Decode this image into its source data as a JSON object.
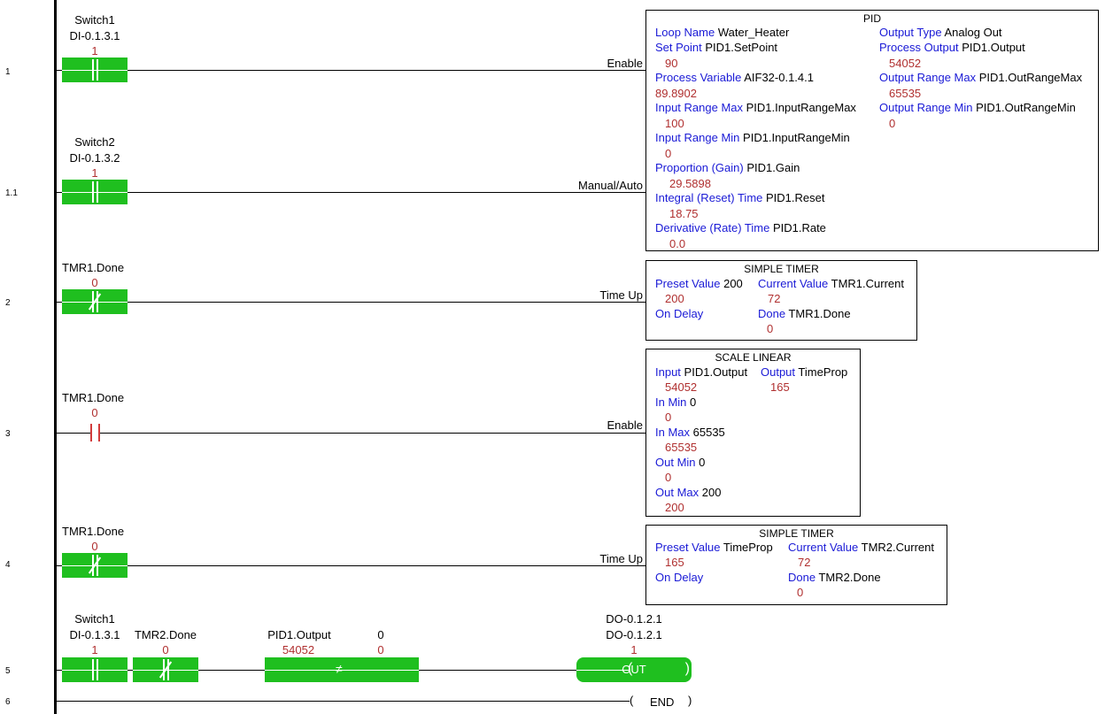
{
  "rungs": {
    "r1": "1",
    "r1_1": "1.1",
    "r2": "2",
    "r3": "3",
    "r4": "4",
    "r5": "5",
    "r6": "6"
  },
  "rung1": {
    "contact_name": "Switch1",
    "contact_addr": "DI-0.1.3.1",
    "contact_val": "1",
    "wire_label": "Enable"
  },
  "rung1_1": {
    "contact_name": "Switch2",
    "contact_addr": "DI-0.1.3.2",
    "contact_val": "1",
    "wire_label": "Manual/Auto"
  },
  "pid": {
    "title": "PID",
    "loop_name_k": "Loop Name",
    "loop_name_v": "Water_Heater",
    "set_point_k": "Set Point",
    "set_point_v": "PID1.SetPoint",
    "set_point_val": "90",
    "pv_k": "Process Variable",
    "pv_v": "AIF32-0.1.4.1",
    "pv_val": "89.8902",
    "irmax_k": "Input Range Max",
    "irmax_v": "PID1.InputRangeMax",
    "irmax_val": "100",
    "irmin_k": "Input Range Min",
    "irmin_v": "PID1.InputRangeMin",
    "irmin_val": "0",
    "gain_k": "Proportion (Gain)",
    "gain_v": "PID1.Gain",
    "gain_val": "29.5898",
    "reset_k": "Integral (Reset) Time",
    "reset_v": "PID1.Reset",
    "reset_val": "18.75",
    "rate_k": "Derivative (Rate) Time",
    "rate_v": "PID1.Rate",
    "rate_val": "0.0",
    "otype_k": "Output Type",
    "otype_v": "Analog Out",
    "pout_k": "Process Output",
    "pout_v": "PID1.Output",
    "pout_val": "54052",
    "ormax_k": "Output Range Max",
    "ormax_v": "PID1.OutRangeMax",
    "ormax_val": "65535",
    "ormin_k": "Output Range Min",
    "ormin_v": "PID1.OutRangeMin",
    "ormin_val": "0"
  },
  "rung2": {
    "contact_name": "TMR1.Done",
    "contact_val": "0",
    "wire_label": "Time Up",
    "timer_title": "SIMPLE TIMER",
    "preset_k": "Preset Value",
    "preset_v": "200",
    "preset_val": "200",
    "current_k": "Current Value",
    "current_v": "TMR1.Current",
    "current_val": "72",
    "ondelay": "On Delay",
    "done_k": "Done",
    "done_v": "TMR1.Done",
    "done_val": "0"
  },
  "rung3": {
    "contact_name": "TMR1.Done",
    "contact_val": "0",
    "wire_label": "Enable",
    "scale_title": "SCALE LINEAR",
    "input_k": "Input",
    "input_v": "PID1.Output",
    "input_val": "54052",
    "output_k": "Output",
    "output_v": "TimeProp",
    "output_val": "165",
    "inmin_k": "In Min",
    "inmin_v": "0",
    "inmin_val": "0",
    "inmax_k": "In Max",
    "inmax_v": "65535",
    "inmax_val": "65535",
    "outmin_k": "Out Min",
    "outmin_v": "0",
    "outmin_val": "0",
    "outmax_k": "Out Max",
    "outmax_v": "200",
    "outmax_val": "200"
  },
  "rung4": {
    "contact_name": "TMR1.Done",
    "contact_val": "0",
    "wire_label": "Time Up",
    "timer_title": "SIMPLE TIMER",
    "preset_k": "Preset Value",
    "preset_v": "TimeProp",
    "preset_val": "165",
    "current_k": "Current Value",
    "current_v": "TMR2.Current",
    "current_val": "72",
    "ondelay": "On Delay",
    "done_k": "Done",
    "done_v": "TMR2.Done",
    "done_val": "0"
  },
  "rung5": {
    "c1_name": "Switch1",
    "c1_addr": "DI-0.1.3.1",
    "c1_val": "1",
    "c2_name": "TMR2.Done",
    "c2_val": "0",
    "cmp_a": "PID1.Output",
    "cmp_a_val": "54052",
    "cmp_b": "0",
    "cmp_b_val": "0",
    "cmp_sym": "≠",
    "coil_addr1": "DO-0.1.2.1",
    "coil_addr2": "DO-0.1.2.1",
    "coil_val": "1",
    "coil_text": "OUT"
  },
  "rung6": {
    "end_text": "END",
    "paren_l": "(",
    "paren_r": ")"
  },
  "colors": {
    "energized": "#1fbf1f",
    "value": "#b03030",
    "keyword": "#1a1ad6"
  }
}
